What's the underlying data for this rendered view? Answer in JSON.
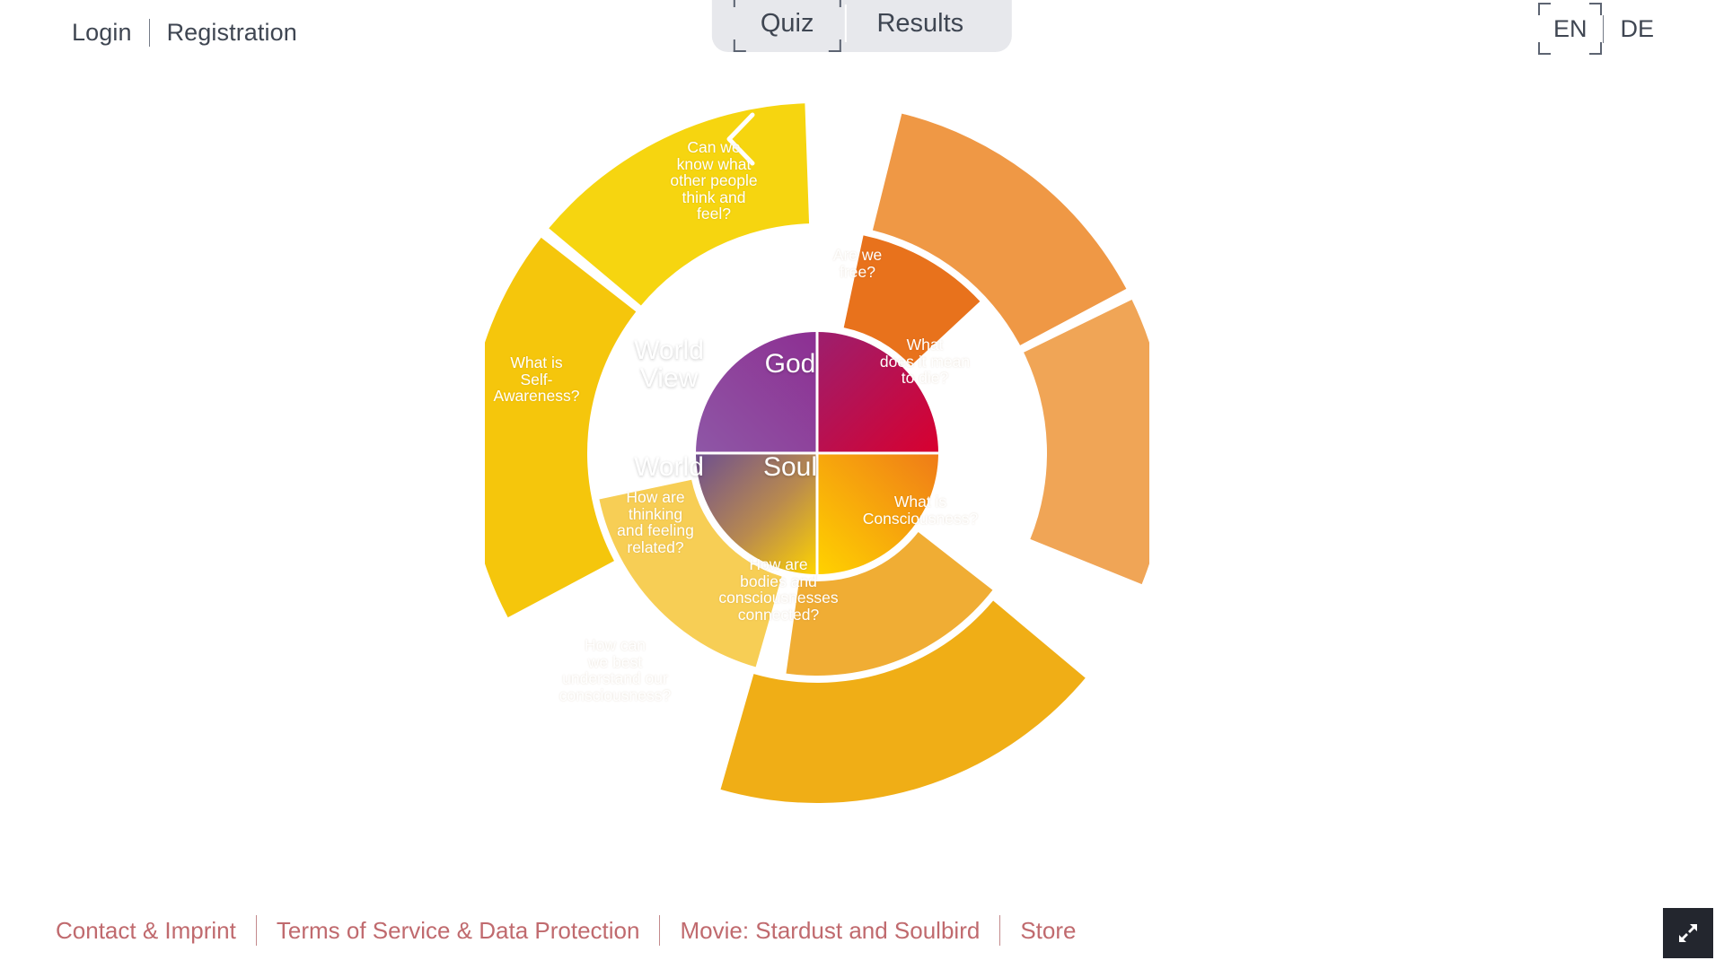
{
  "header": {
    "auth": {
      "login_label": "Login",
      "registration_label": "Registration"
    },
    "tabs": [
      {
        "label": "Quiz",
        "active": true
      },
      {
        "label": "Results",
        "active": false
      }
    ],
    "languages": [
      {
        "code": "EN",
        "active": true
      },
      {
        "code": "DE",
        "active": false
      }
    ]
  },
  "wheel": {
    "back_icon": "chevron-left-icon",
    "hub": [
      {
        "key": "world-view",
        "label": "World\nView",
        "color_from": "#7b3f98",
        "color_to": "#8e4c9e"
      },
      {
        "key": "god",
        "label": "God",
        "color_from": "#9c1f6e",
        "color_to": "#d8002f"
      },
      {
        "key": "world",
        "label": "World",
        "color_from": "#6f4a8e",
        "color_to": "#ffd400"
      },
      {
        "key": "soul",
        "label": "Soul",
        "color_from": "#ffd200",
        "color_to": "#ef7b18"
      }
    ],
    "segments": [
      {
        "key": "know-others",
        "label": "Can we\nknow what\nother people\nthink and\nfeel?",
        "ring": "outer",
        "color": "#f6d510"
      },
      {
        "key": "self-awareness",
        "label": "What is\nSelf-\nAwareness?",
        "ring": "outer",
        "color": "#f5c60c"
      },
      {
        "key": "are-we-free",
        "label": "Are we\nfree?",
        "ring": "inner",
        "color": "#e8721c"
      },
      {
        "key": "mean-to-die",
        "label": "What\ndoes it mean\nto die?",
        "ring": "outer",
        "color": "#ef9845"
      },
      {
        "key": "consciousness",
        "label": "What is\nConsciousness?",
        "ring": "outer",
        "color": "#f0a556"
      },
      {
        "key": "bodies-connected",
        "label": "How are\nbodies and\nconsciousnesses\nconnected?",
        "ring": "inner",
        "color": "#f0ad34"
      },
      {
        "key": "thinking-feeling",
        "label": "How are\nthinking\nand feeling\nrelated?",
        "ring": "inner",
        "color": "#f7ce55"
      },
      {
        "key": "understand-consc",
        "label": "How can\nwe best\nunderstand our\nconsciousness?",
        "ring": "outer",
        "color": "#f0ae16"
      }
    ]
  },
  "footer": {
    "links": [
      {
        "label": "Contact & Imprint"
      },
      {
        "label": "Terms of Service & Data Protection"
      },
      {
        "label": "Movie: Stardust and Soulbird"
      },
      {
        "label": "Store"
      }
    ],
    "link_color": "#c06a6e",
    "fullscreen_icon": "fullscreen-expand-icon"
  }
}
